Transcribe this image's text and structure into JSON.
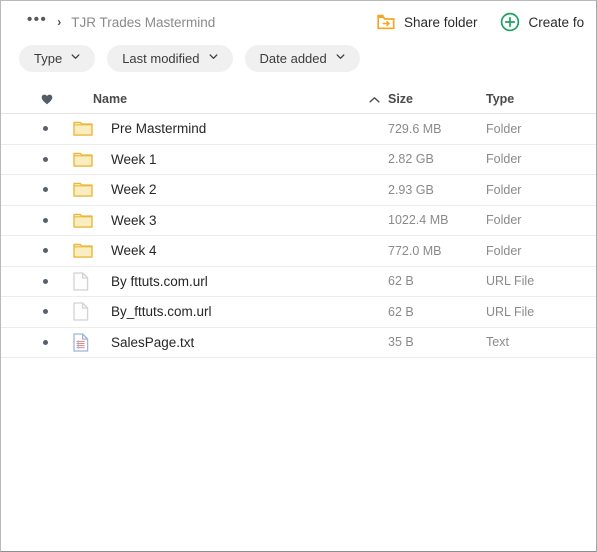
{
  "window": {
    "background": "#ffffff",
    "border_color": "#b9b9b9"
  },
  "topbar": {
    "breadcrumb": {
      "overflow_label": "•••",
      "separator": "›",
      "current_folder": "TJR Trades Mastermind"
    },
    "actions": [
      {
        "label": "Share folder",
        "icon": "share-folder-icon",
        "color": "#f5a623"
      },
      {
        "label": "Create fo",
        "icon": "plus-circle-icon",
        "color": "#1aa260"
      }
    ]
  },
  "filters": [
    {
      "label": "Type",
      "icon": "chevron-down-icon"
    },
    {
      "label": "Last modified",
      "icon": "chevron-down-icon"
    },
    {
      "label": "Date added",
      "icon": "chevron-down-icon"
    }
  ],
  "table": {
    "columns": {
      "favorite": "favorite-heart-icon",
      "name": "Name",
      "sort_direction": "ascending",
      "size": "Size",
      "type": "Type"
    },
    "rows": [
      {
        "name": "Pre Mastermind",
        "size": "729.6 MB",
        "type": "Folder",
        "icon": "folder-icon"
      },
      {
        "name": "Week 1",
        "size": "2.82 GB",
        "type": "Folder",
        "icon": "folder-icon"
      },
      {
        "name": "Week 2",
        "size": "2.93 GB",
        "type": "Folder",
        "icon": "folder-icon"
      },
      {
        "name": "Week 3",
        "size": "1022.4 MB",
        "type": "Folder",
        "icon": "folder-icon"
      },
      {
        "name": "Week 4",
        "size": "772.0 MB",
        "type": "Folder",
        "icon": "folder-icon"
      },
      {
        "name": "By fttuts.com.url",
        "size": "62 B",
        "type": "URL File",
        "icon": "blank-document-icon"
      },
      {
        "name": "By_fttuts.com.url",
        "size": "62 B",
        "type": "URL File",
        "icon": "blank-document-icon"
      },
      {
        "name": "SalesPage.txt",
        "size": "35 B",
        "type": "Text",
        "icon": "text-document-icon"
      }
    ]
  },
  "colors": {
    "folder_fill": "#faeec0",
    "folder_stroke": "#e9b93c",
    "accent_orange": "#f5a623",
    "accent_green": "#1aa260",
    "text_primary": "#262626",
    "text_muted": "#8a8a8a",
    "divider": "#ececec"
  }
}
